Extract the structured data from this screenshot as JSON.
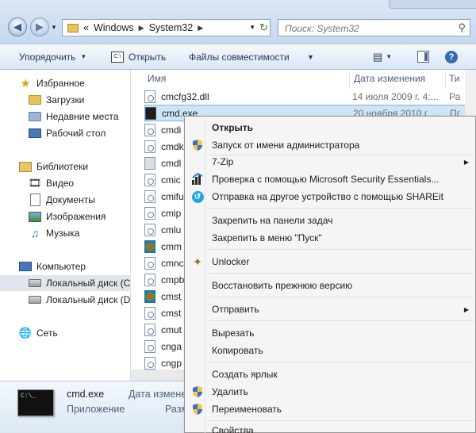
{
  "address": {
    "prefix": "«",
    "crumbs": [
      "Windows",
      "System32"
    ]
  },
  "search": {
    "placeholder": "Поиск: System32"
  },
  "toolbar": {
    "organize": "Упорядочить",
    "open": "Открыть",
    "compat": "Файлы совместимости"
  },
  "nav": {
    "favorites": "Избранное",
    "downloads": "Загрузки",
    "recent": "Недавние места",
    "desktop": "Рабочий стол",
    "libraries": "Библиотеки",
    "video": "Видео",
    "documents": "Документы",
    "images": "Изображения",
    "music": "Музыка",
    "computer": "Компьютер",
    "drive_c": "Локальный диск (C",
    "drive_d": "Локальный диск (D",
    "network": "Сеть"
  },
  "columns": {
    "name": "Имя",
    "date": "Дата изменения",
    "type": "Ти"
  },
  "files": [
    {
      "name": "cmcfg32.dll",
      "date": "14 июля 2009 г. 4:...",
      "type": "Ра"
    },
    {
      "name": "cmd.exe",
      "date": "20 ноября 2010 г. ...",
      "type": "Пг"
    },
    {
      "name": "cmdi",
      "date": "",
      "type": ""
    },
    {
      "name": "cmdk",
      "date": "",
      "type": ""
    },
    {
      "name": "cmdl",
      "date": "",
      "type": ""
    },
    {
      "name": "cmic",
      "date": "",
      "type": ""
    },
    {
      "name": "cmifu",
      "date": "",
      "type": ""
    },
    {
      "name": "cmip",
      "date": "",
      "type": ""
    },
    {
      "name": "cmlu",
      "date": "",
      "type": ""
    },
    {
      "name": "cmm",
      "date": "",
      "type": ""
    },
    {
      "name": "cmnc",
      "date": "",
      "type": ""
    },
    {
      "name": "cmpb",
      "date": "",
      "type": ""
    },
    {
      "name": "cmst",
      "date": "",
      "type": ""
    },
    {
      "name": "cmst",
      "date": "",
      "type": ""
    },
    {
      "name": "cmut",
      "date": "",
      "type": ""
    },
    {
      "name": "cnga",
      "date": "",
      "type": ""
    },
    {
      "name": "cngp",
      "date": "",
      "type": ""
    }
  ],
  "details": {
    "name": "cmd.exe",
    "type": "Приложение",
    "date_label": "Дата изменен",
    "size_label": "Разм",
    "thumb_text": "C:\\_"
  },
  "menu": {
    "open": "Открыть",
    "run_as_admin": "Запуск от имени администратора",
    "sevenzip": "7-Zip",
    "mse": "Проверка с помощью Microsoft Security Essentials...",
    "shareit": "Отправка на другое устройство с помощью SHAREit",
    "pin_taskbar": "Закрепить на панели задач",
    "pin_start": "Закрепить в меню \"Пуск\"",
    "unlocker": "Unlocker",
    "restore": "Восстановить прежнюю версию",
    "send_to": "Отправить",
    "cut": "Вырезать",
    "copy": "Копировать",
    "create_shortcut": "Создать ярлык",
    "delete": "Удалить",
    "rename": "Переименовать",
    "properties": "Свойства"
  },
  "colors": {
    "accent": "#2f6db3",
    "selection": "#cde6f7",
    "menu_bg": "#f5f5f5"
  }
}
